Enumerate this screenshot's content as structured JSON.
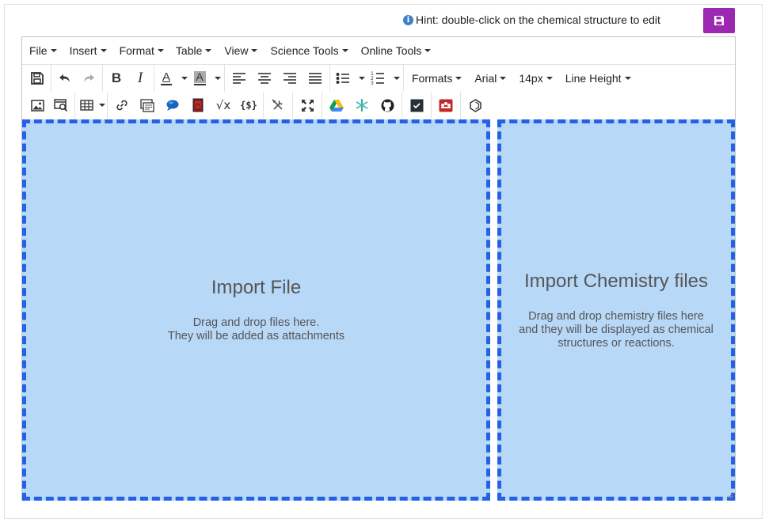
{
  "hint": {
    "icon": "info-icon",
    "icon_glyph": "i",
    "text": "Hint: double-click on the chemical structure to edit"
  },
  "top_save_button": {
    "icon": "save-icon",
    "color": "#9c27b0"
  },
  "menubar": {
    "items": [
      {
        "label": "File"
      },
      {
        "label": "Insert"
      },
      {
        "label": "Format"
      },
      {
        "label": "Table"
      },
      {
        "label": "View"
      },
      {
        "label": "Science Tools"
      },
      {
        "label": "Online Tools"
      }
    ]
  },
  "toolbar1": {
    "formats_label": "Formats",
    "font_label": "Arial",
    "size_label": "14px",
    "line_height_label": "Line Height",
    "text_color_letter": "A",
    "bg_color_letter": "A",
    "bold_letter": "B",
    "italic_letter": "I",
    "icons": [
      "save-icon",
      "undo-icon",
      "redo-icon",
      "bold-icon",
      "italic-icon",
      "text-color-icon",
      "background-color-icon",
      "align-left-icon",
      "align-center-icon",
      "align-right-icon",
      "justify-icon",
      "bullet-list-icon",
      "numbered-list-icon"
    ]
  },
  "toolbar2": {
    "sqrt_label": "√x",
    "braces_label": "{$}",
    "icons": [
      "image-icon",
      "image-search-icon",
      "table-icon",
      "link-icon",
      "embed-icon",
      "comment-icon",
      "pdf-icon",
      "math-icon",
      "code-braces-icon",
      "tools-icon",
      "fullscreen-icon",
      "google-drive-icon",
      "chemistry-icon",
      "github-icon",
      "checkbox-icon",
      "mendeley-icon",
      "molecule-icon"
    ]
  },
  "dropzones": {
    "left": {
      "title": "Import File",
      "line1": "Drag and drop files here.",
      "line2": "They will be added as attachments"
    },
    "right": {
      "title": "Import Chemistry files",
      "line1": "Drag and drop chemistry files here",
      "line2": "and they will be displayed as chemical",
      "line3": "structures or reactions."
    }
  },
  "colors": {
    "dropzone_fill": "#b8d8f8",
    "dropzone_border": "#2561e6",
    "accent": "#9c27b0"
  }
}
